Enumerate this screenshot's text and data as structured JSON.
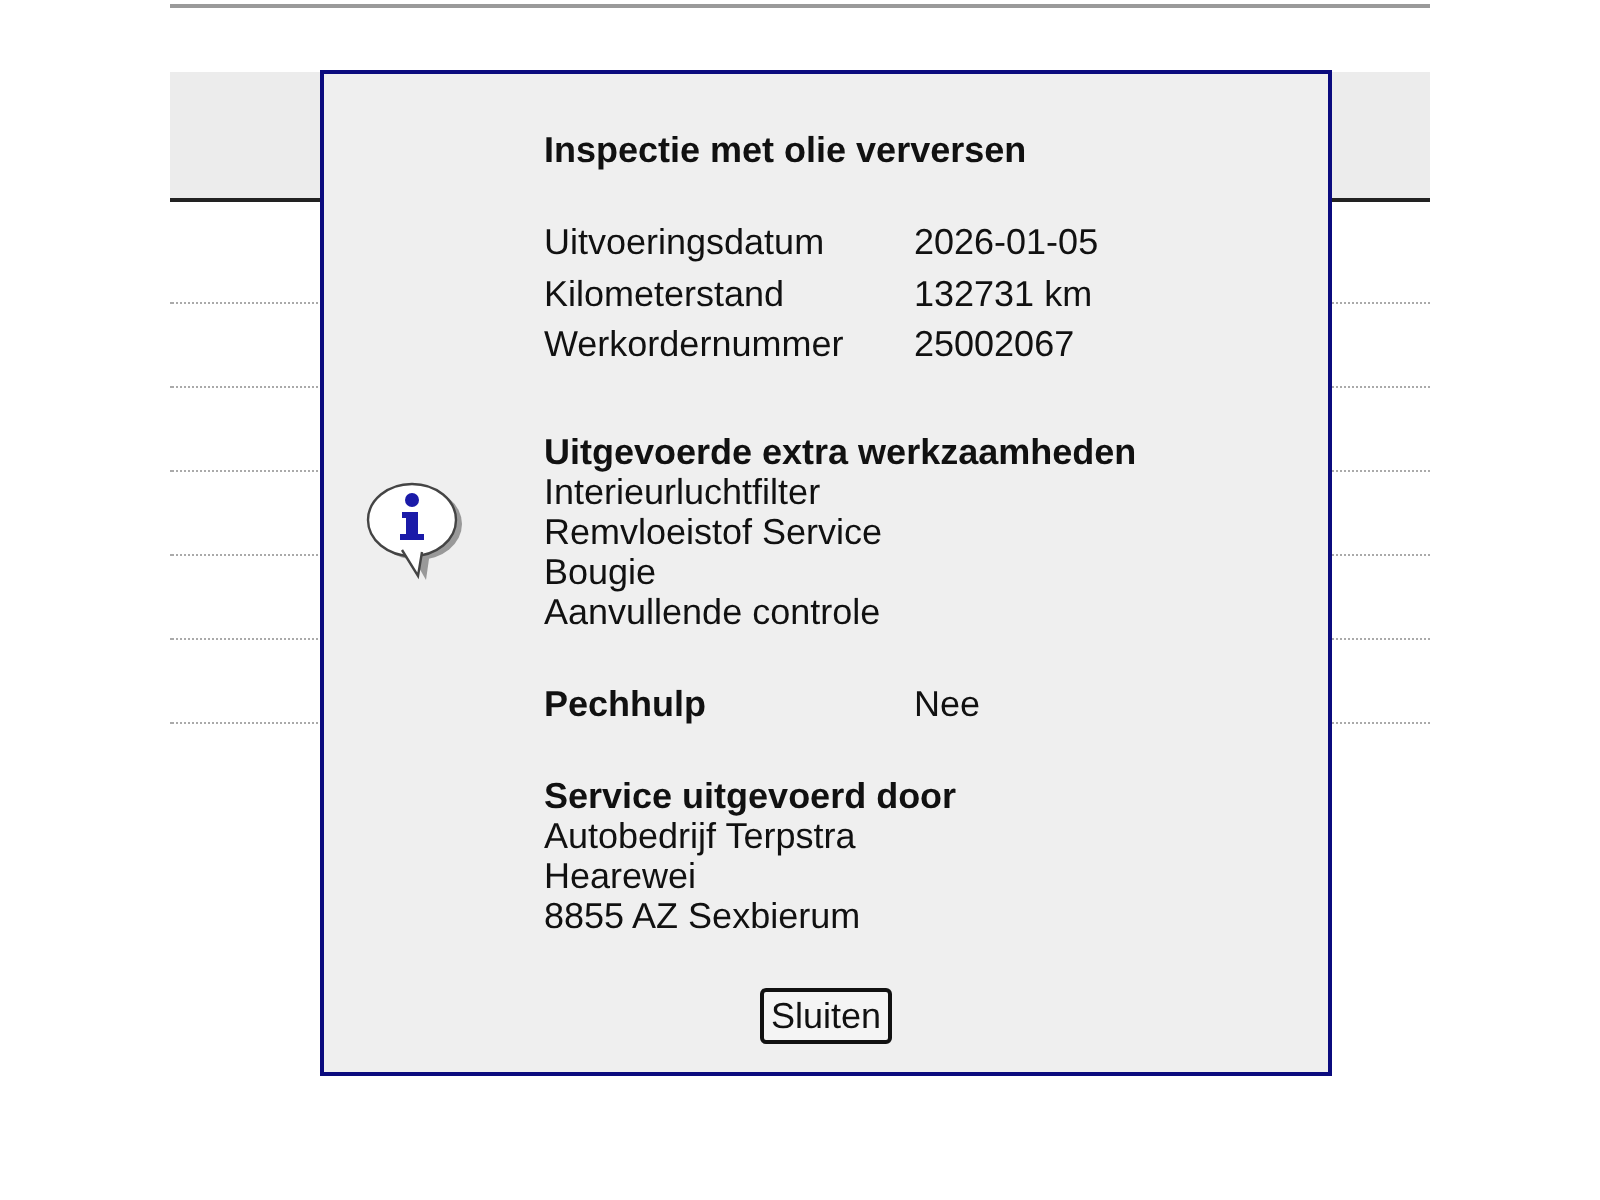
{
  "dialog": {
    "title": "Inspectie met olie verversen",
    "details": [
      {
        "label": "Uitvoeringsdatum",
        "value": "2026-01-05"
      },
      {
        "label": "Kilometerstand",
        "value": "132731 km"
      },
      {
        "label": "Werkordernummer",
        "value": "25002067"
      }
    ],
    "extra_work": {
      "heading": "Uitgevoerde extra werkzaamheden",
      "items": [
        "Interieurluchtfilter",
        "Remvloeistof Service",
        "Bougie",
        "Aanvullende controle"
      ]
    },
    "breakdown_assistance": {
      "label": "Pechhulp",
      "value": "Nee"
    },
    "service_provider": {
      "heading": "Service uitgevoerd door",
      "lines": [
        "Autobedrijf Terpstra",
        "Hearewei",
        "8855 AZ Sexbierum"
      ]
    },
    "buttons": [
      "Sluiten"
    ]
  }
}
